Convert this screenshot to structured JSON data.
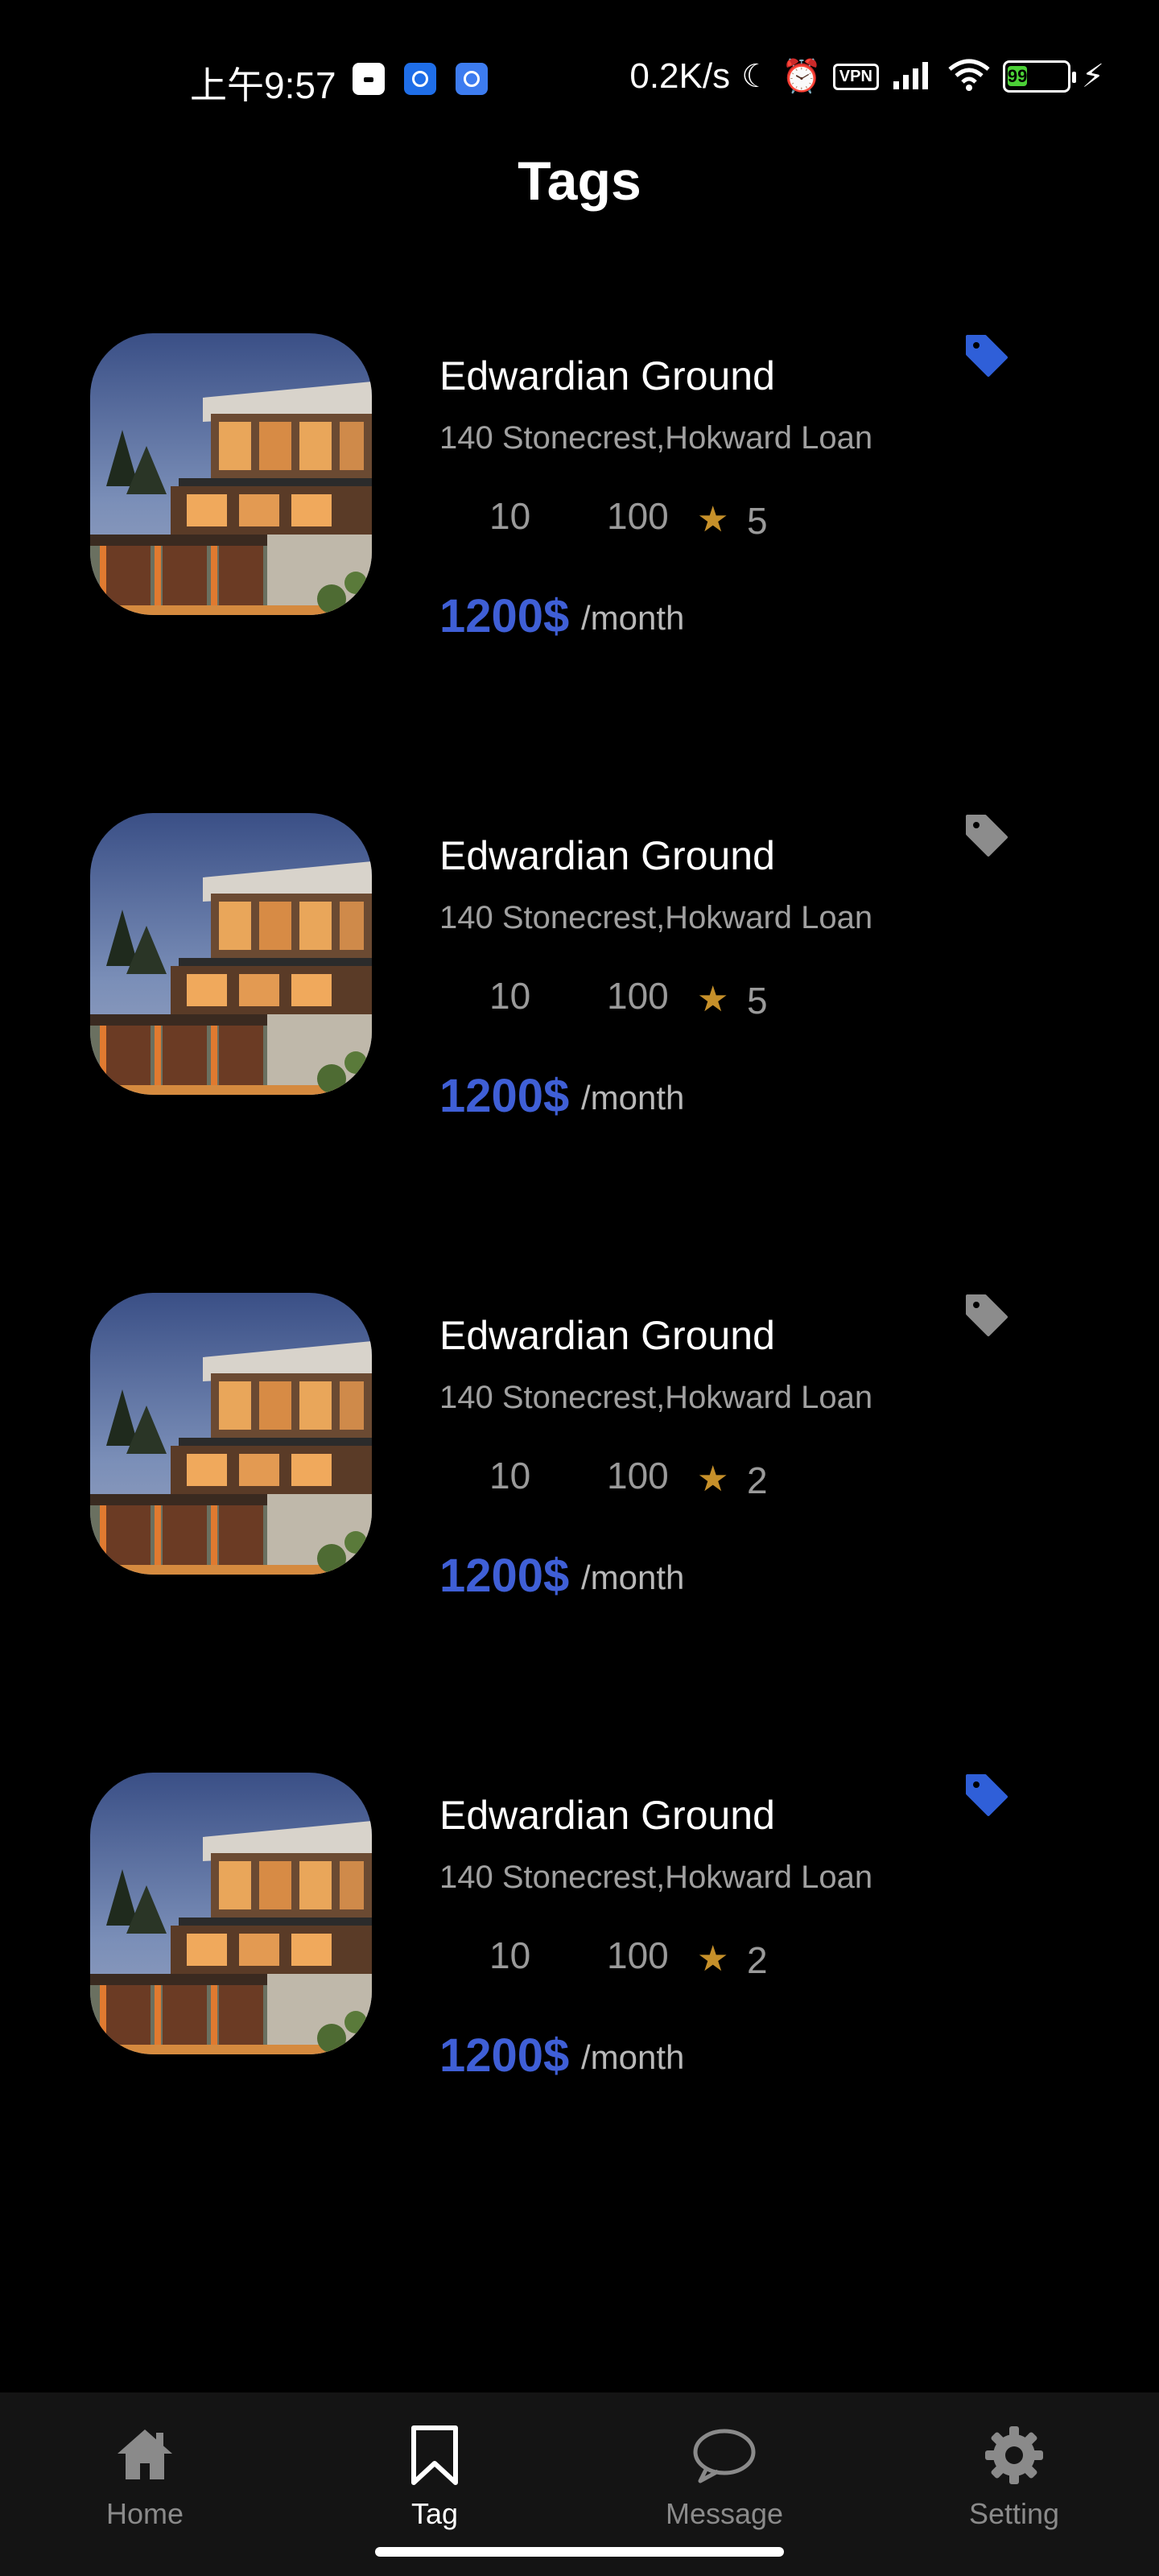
{
  "status_bar": {
    "time": "上午9:57",
    "speed": "0.2K/s",
    "vpn": "VPN",
    "battery": "99"
  },
  "page_title": "Tags",
  "listings": [
    {
      "name": "Edwardian Ground",
      "address": "140 Stonecrest,Hokward Loan",
      "beds": "10",
      "area": "100",
      "rating": "5",
      "price": "1200$",
      "period": "/month",
      "tagged": true
    },
    {
      "name": "Edwardian Ground",
      "address": "140 Stonecrest,Hokward Loan",
      "beds": "10",
      "area": "100",
      "rating": "5",
      "price": "1200$",
      "period": "/month",
      "tagged": false
    },
    {
      "name": "Edwardian Ground",
      "address": "140 Stonecrest,Hokward Loan",
      "beds": "10",
      "area": "100",
      "rating": "2",
      "price": "1200$",
      "period": "/month",
      "tagged": false
    },
    {
      "name": "Edwardian Ground",
      "address": "140 Stonecrest,Hokward Loan",
      "beds": "10",
      "area": "100",
      "rating": "2",
      "price": "1200$",
      "period": "/month",
      "tagged": true
    }
  ],
  "nav": {
    "items": [
      {
        "label": "Home",
        "icon": "home-icon"
      },
      {
        "label": "Tag",
        "icon": "bookmark-icon"
      },
      {
        "label": "Message",
        "icon": "chat-bubble-icon"
      },
      {
        "label": "Setting",
        "icon": "gear-icon"
      }
    ],
    "active": "Tag"
  },
  "colors": {
    "accent": "#3f5fd6",
    "tag_active": "#2f5fd8",
    "tag_inactive": "#8c8c8c",
    "star": "#c6902a",
    "background": "#000000",
    "nav_background": "#141414"
  }
}
